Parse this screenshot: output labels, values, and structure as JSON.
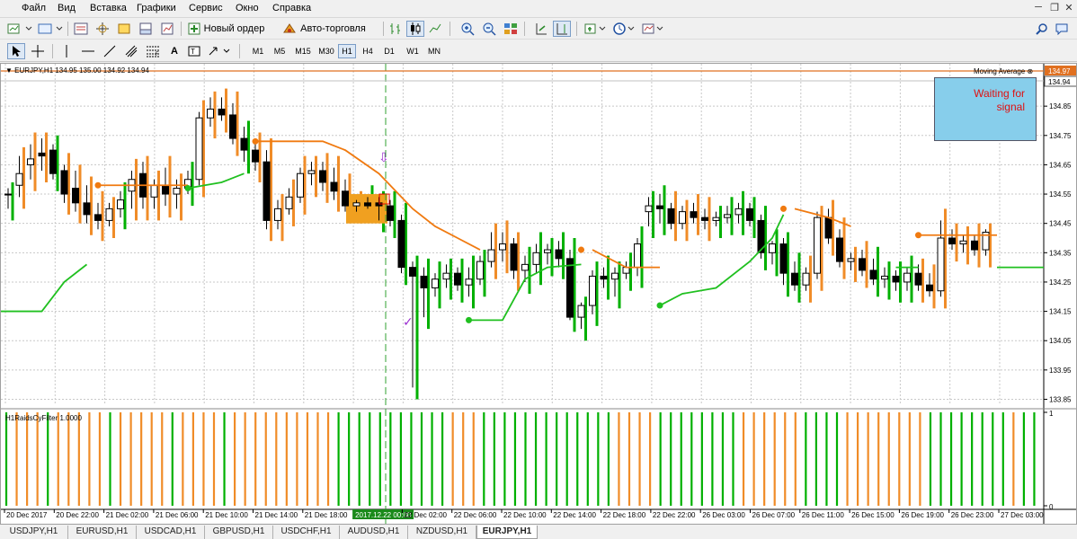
{
  "menu": [
    "Файл",
    "Вид",
    "Вставка",
    "Графики",
    "Сервис",
    "Окно",
    "Справка"
  ],
  "toolbar": {
    "new_order_label": "Новый ордер",
    "autotrade_label": "Авто-торговля"
  },
  "timeframes": [
    "M1",
    "M5",
    "M15",
    "M30",
    "H1",
    "H4",
    "D1",
    "W1",
    "MN"
  ],
  "active_timeframe": "H1",
  "chart": {
    "header": "EURJPY,H1  134.95 135.00 134.92 134.94",
    "ma_label": "Moving Average",
    "price_tag_top": "134.97",
    "price_tag_current": "134.94",
    "subwindow_label": "H1RaidsCyFilter 1.0000",
    "signal_text": "Waiting for signal",
    "current_time_label": "2017.12.22 00:00"
  },
  "chart_data": {
    "type": "candlestick",
    "symbol": "EURJPY",
    "timeframe": "H1",
    "y_ticks": [
      "134.85",
      "134.75",
      "134.65",
      "134.55",
      "134.45",
      "134.35",
      "134.25",
      "134.15",
      "134.05",
      "133.95",
      "133.85"
    ],
    "ylim": [
      133.83,
      134.97
    ],
    "sub_y_ticks": [
      "1",
      "0"
    ],
    "x_labels": [
      "20 Dec 2017",
      "20 Dec 22:00",
      "21 Dec 02:00",
      "21 Dec 06:00",
      "21 Dec 10:00",
      "21 Dec 14:00",
      "21 Dec 18:00",
      "2017.12.22 00:00",
      "22 Dec 02:00",
      "22 Dec 06:00",
      "22 Dec 10:00",
      "22 Dec 14:00",
      "22 Dec 18:00",
      "22 Dec 22:00",
      "26 Dec 03:00",
      "26 Dec 07:00",
      "26 Dec 11:00",
      "26 Dec 15:00",
      "26 Dec 19:00",
      "26 Dec 23:00",
      "27 Dec 03:00"
    ],
    "colors": {
      "bull_trend": "#00b000",
      "bear_trend": "#f08c28",
      "bear_line": "#f07a10",
      "bull_line": "#20c020",
      "marker_checkmark": "#9b30d0",
      "marker_arrow": "#9b30d0"
    },
    "candles": [
      [
        134.55,
        134.57,
        134.5,
        134.55
      ],
      [
        134.58,
        134.68,
        134.54,
        134.62
      ],
      [
        134.65,
        134.72,
        134.6,
        134.67
      ],
      [
        134.69,
        134.74,
        134.63,
        134.68
      ],
      [
        134.7,
        134.72,
        134.6,
        134.62
      ],
      [
        134.63,
        134.65,
        134.52,
        134.55
      ],
      [
        134.57,
        134.63,
        134.49,
        134.52
      ],
      [
        134.52,
        134.58,
        134.45,
        134.48
      ],
      [
        134.48,
        134.52,
        134.43,
        134.46
      ],
      [
        134.46,
        134.52,
        134.44,
        134.5
      ],
      [
        134.5,
        134.56,
        134.47,
        134.53
      ],
      [
        134.56,
        134.63,
        134.5,
        134.6
      ],
      [
        134.62,
        134.66,
        134.5,
        134.54
      ],
      [
        134.54,
        134.6,
        134.5,
        134.58
      ],
      [
        134.58,
        134.64,
        134.51,
        134.55
      ],
      [
        134.55,
        134.6,
        134.5,
        134.57
      ],
      [
        134.57,
        134.63,
        134.55,
        134.6
      ],
      [
        134.6,
        134.83,
        134.58,
        134.81
      ],
      [
        134.81,
        134.88,
        134.78,
        134.84
      ],
      [
        134.84,
        134.88,
        134.8,
        134.82
      ],
      [
        134.82,
        134.86,
        134.72,
        134.74
      ],
      [
        134.74,
        134.78,
        134.66,
        134.7
      ],
      [
        134.7,
        134.73,
        134.63,
        134.66
      ],
      [
        134.66,
        134.7,
        134.43,
        134.46
      ],
      [
        134.46,
        134.53,
        134.43,
        134.5
      ],
      [
        134.5,
        134.57,
        134.48,
        134.54
      ],
      [
        134.54,
        134.64,
        134.52,
        134.62
      ],
      [
        134.62,
        134.66,
        134.58,
        134.63
      ],
      [
        134.63,
        134.66,
        134.56,
        134.59
      ],
      [
        134.59,
        134.64,
        134.53,
        134.56
      ],
      [
        134.56,
        134.6,
        134.49,
        134.51
      ],
      [
        134.51,
        134.53,
        134.49,
        134.52
      ],
      [
        134.52,
        134.54,
        134.5,
        134.51
      ],
      [
        134.52,
        134.54,
        134.46,
        134.51
      ],
      [
        134.51,
        134.53,
        134.44,
        134.46
      ],
      [
        134.46,
        134.48,
        134.28,
        134.3
      ],
      [
        134.3,
        134.32,
        133.89,
        134.27
      ],
      [
        134.27,
        134.3,
        134.13,
        134.23
      ],
      [
        134.23,
        134.28,
        134.2,
        134.26
      ],
      [
        134.26,
        134.31,
        134.23,
        134.28
      ],
      [
        134.28,
        134.3,
        134.22,
        134.24
      ],
      [
        134.24,
        134.3,
        134.2,
        134.26
      ],
      [
        134.26,
        134.34,
        134.24,
        134.32
      ],
      [
        134.32,
        134.42,
        134.3,
        134.36
      ],
      [
        134.36,
        134.42,
        134.32,
        134.38
      ],
      [
        134.38,
        134.4,
        134.26,
        134.29
      ],
      [
        134.29,
        134.34,
        134.25,
        134.31
      ],
      [
        134.31,
        134.38,
        134.28,
        134.35
      ],
      [
        134.35,
        134.38,
        134.31,
        134.36
      ],
      [
        134.36,
        134.39,
        134.3,
        134.33
      ],
      [
        134.33,
        134.36,
        134.12,
        134.13
      ],
      [
        134.13,
        134.18,
        134.09,
        134.17
      ],
      [
        134.17,
        134.29,
        134.14,
        134.27
      ],
      [
        134.27,
        134.3,
        134.23,
        134.26
      ],
      [
        134.26,
        134.3,
        134.2,
        134.28
      ],
      [
        134.28,
        134.32,
        134.26,
        134.3
      ],
      [
        134.3,
        134.4,
        134.27,
        134.38
      ],
      [
        134.49,
        134.54,
        134.44,
        134.51
      ],
      [
        134.51,
        134.55,
        134.45,
        134.5
      ],
      [
        134.5,
        134.52,
        134.43,
        134.45
      ],
      [
        134.45,
        134.51,
        134.43,
        134.49
      ],
      [
        134.49,
        134.52,
        134.45,
        134.47
      ],
      [
        134.47,
        134.5,
        134.43,
        134.46
      ],
      [
        134.46,
        134.49,
        134.44,
        134.47
      ],
      [
        134.47,
        134.51,
        134.45,
        134.48
      ],
      [
        134.48,
        134.52,
        134.45,
        134.5
      ],
      [
        134.5,
        134.52,
        134.44,
        134.46
      ],
      [
        134.46,
        134.48,
        134.33,
        134.35
      ],
      [
        134.35,
        134.39,
        134.31,
        134.38
      ],
      [
        134.38,
        134.4,
        134.24,
        134.28
      ],
      [
        134.28,
        134.32,
        134.22,
        134.24
      ],
      [
        134.24,
        134.3,
        134.22,
        134.28
      ],
      [
        134.28,
        134.49,
        134.26,
        134.47
      ],
      [
        134.47,
        134.5,
        134.38,
        134.4
      ],
      [
        134.4,
        134.43,
        134.3,
        134.32
      ],
      [
        134.32,
        134.35,
        134.29,
        134.33
      ],
      [
        134.33,
        134.36,
        134.27,
        134.29
      ],
      [
        134.29,
        134.33,
        134.24,
        134.26
      ],
      [
        134.26,
        134.3,
        134.23,
        134.27
      ],
      [
        134.27,
        134.29,
        134.22,
        134.25
      ],
      [
        134.25,
        134.3,
        134.22,
        134.28
      ],
      [
        134.28,
        134.31,
        134.22,
        134.24
      ],
      [
        134.24,
        134.28,
        134.2,
        134.22
      ],
      [
        134.22,
        134.46,
        134.2,
        134.4
      ],
      [
        134.4,
        134.43,
        134.36,
        134.38
      ],
      [
        134.38,
        134.41,
        134.35,
        134.39
      ],
      [
        134.39,
        134.41,
        134.34,
        134.36
      ],
      [
        134.36,
        134.43,
        134.34,
        134.42
      ]
    ],
    "sub_bars": "GOOOGOOOOOGOOOOOGOOOOGOOOOOOOOOOGGGGGGGGGGGOOOGGGGGGGGGGGGGOOOOGGGGGGGGOOOOOOGGGGOOOOOOOOGGGGGGGGOGG"
  },
  "tabs": [
    "USDJPY,H1",
    "EURUSD,H1",
    "USDCAD,H1",
    "GBPUSD,H1",
    "USDCHF,H1",
    "AUDUSD,H1",
    "NZDUSD,H1",
    "EURJPY,H1"
  ],
  "active_tab": "EURJPY,H1"
}
